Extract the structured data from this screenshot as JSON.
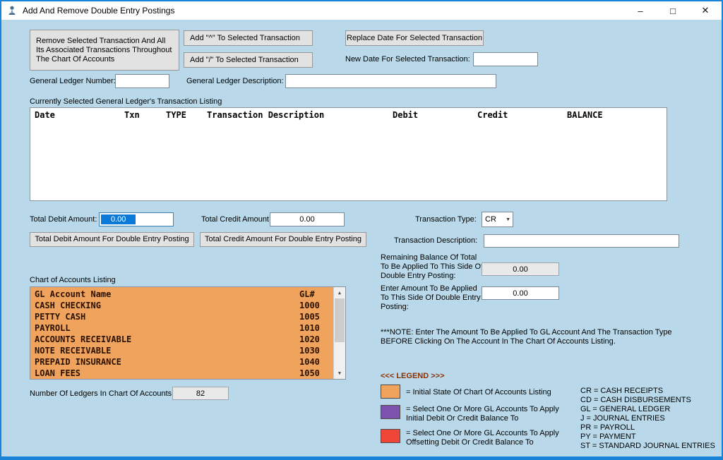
{
  "window": {
    "title": "Add And Remove Double Entry Postings",
    "minimize_glyph": "–",
    "maximize_glyph": "□",
    "close_glyph": "✕"
  },
  "actions": {
    "remove_button": "Remove Selected Transaction And All Its Associated Transactions Throughout The Chart Of Accounts",
    "add_caret_button": "Add \"^\" To Selected Transaction",
    "add_slash_button": "Add \"/\" To Selected Transaction",
    "replace_date_button": "Replace Date For Selected Transaction",
    "new_date_label": "New Date For Selected Transaction:",
    "new_date_value": ""
  },
  "general_ledger": {
    "number_label": "General Ledger Number:",
    "number_value": "",
    "description_label": "General Ledger Description:",
    "description_value": ""
  },
  "transaction_listing": {
    "caption": "Currently Selected General Ledger's Transaction Listing",
    "columns": [
      "Date",
      "Txn",
      "TYPE",
      "Transaction Description",
      "Debit",
      "Credit",
      "BALANCE"
    ]
  },
  "totals": {
    "debit_label": "Total Debit Amount:",
    "debit_value": "0.00",
    "credit_label": "Total Credit Amount:",
    "credit_value": "0.00",
    "debit_posting_button": "Total Debit Amount For Double Entry Posting",
    "credit_posting_button": "Total Credit Amount For Double Entry Posting"
  },
  "transaction_entry": {
    "type_label": "Transaction Type:",
    "type_value": "CR",
    "description_label": "Transaction Description:",
    "description_value": "",
    "remaining_label": "Remaining Balance Of Total To Be Applied To This Side Of Double Entry Posting:",
    "remaining_value": "0.00",
    "amount_label": "Enter Amount To Be Applied To This Side Of Double Entry Posting:",
    "amount_value": "0.00",
    "note": "***NOTE: Enter The Amount To Be Applied To GL Account And The Transaction Type BEFORE Clicking On The Account In The Chart Of Accounts Listing."
  },
  "chart_of_accounts": {
    "caption": "Chart of Accounts Listing",
    "header_name": "GL Account Name",
    "header_number": "GL#",
    "rows": [
      {
        "name": "CASH CHECKING",
        "number": "1000"
      },
      {
        "name": "PETTY CASH",
        "number": "1005"
      },
      {
        "name": "PAYROLL",
        "number": "1010"
      },
      {
        "name": "ACCOUNTS RECEIVABLE",
        "number": "1020"
      },
      {
        "name": "NOTE RECEIVABLE",
        "number": "1030"
      },
      {
        "name": "PREPAID INSURANCE",
        "number": "1040"
      },
      {
        "name": "LOAN FEES",
        "number": "1050"
      }
    ],
    "count_label": "Number Of Ledgers In Chart Of Accounts:",
    "count_value": "82"
  },
  "legend": {
    "title": "<<< LEGEND >>>",
    "items": [
      {
        "color": "#EFA35D",
        "label": "= Initial State Of Chart Of Accounts Listing"
      },
      {
        "color": "#7B52AE",
        "label": "= Select One Or More GL Accounts To Apply Initial Debit Or Credit Balance To"
      },
      {
        "color": "#EE4737",
        "label": "= Select One Or More GL Accounts To Apply Offsetting Debit Or Credit Balance To"
      }
    ],
    "abbreviations": [
      "CR = CASH RECEIPTS",
      "CD = CASH DISBURSEMENTS",
      "GL = GENERAL LEDGER",
      "J = JOURNAL ENTRIES",
      "PR = PAYROLL",
      "PY = PAYMENT",
      "ST = STANDARD JOURNAL ENTRIES"
    ]
  },
  "colors": {
    "window_background": "#B9D9EA",
    "window_border": "#1883D7",
    "selection_blue": "#0B79D7"
  }
}
